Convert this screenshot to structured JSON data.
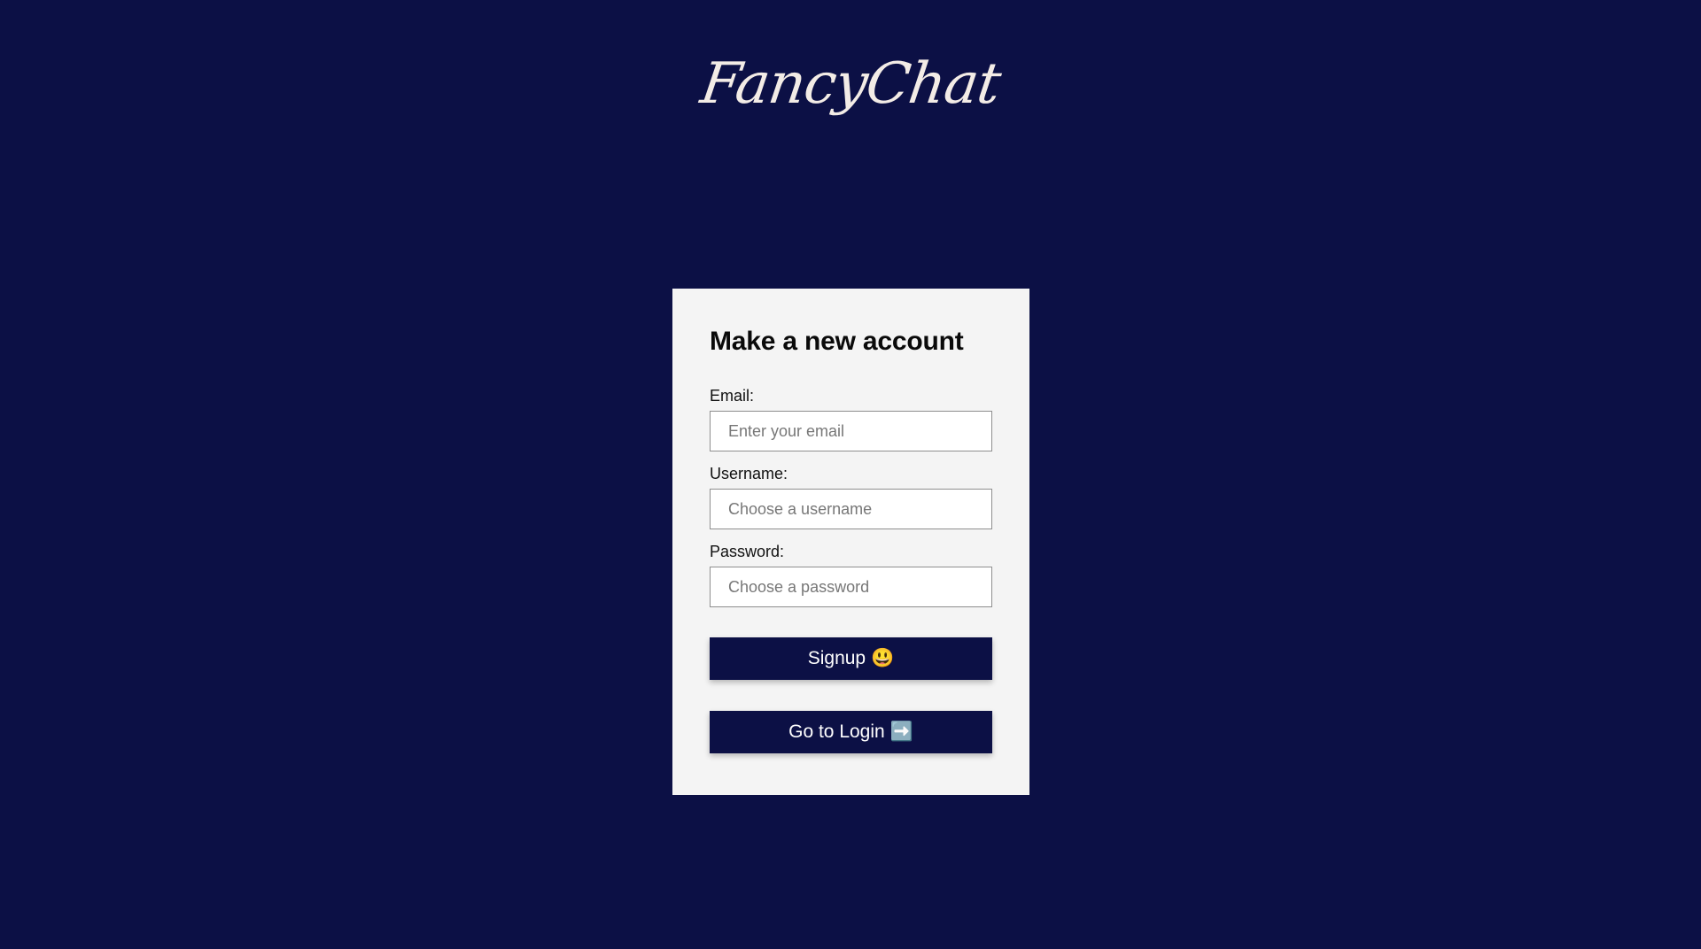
{
  "app": {
    "logo_text": "FancyChat"
  },
  "signup_form": {
    "title": "Make a new account",
    "email": {
      "label": "Email:",
      "placeholder": "Enter your email",
      "value": ""
    },
    "username": {
      "label": "Username:",
      "placeholder": "Choose a username",
      "value": ""
    },
    "password": {
      "label": "Password:",
      "placeholder": "Choose a password",
      "value": ""
    },
    "signup_button": {
      "label": "Signup",
      "icon_glyph": "😃",
      "icon_name": "smiley-icon"
    },
    "login_button": {
      "label": "Go to Login",
      "icon_glyph": "➡️",
      "icon_name": "arrow-right-icon"
    }
  },
  "colors": {
    "background": "#0c1045",
    "card": "#f4f4f4",
    "button": "#0c1045",
    "button_text": "#ffffff",
    "logo": "#f3ece6"
  }
}
